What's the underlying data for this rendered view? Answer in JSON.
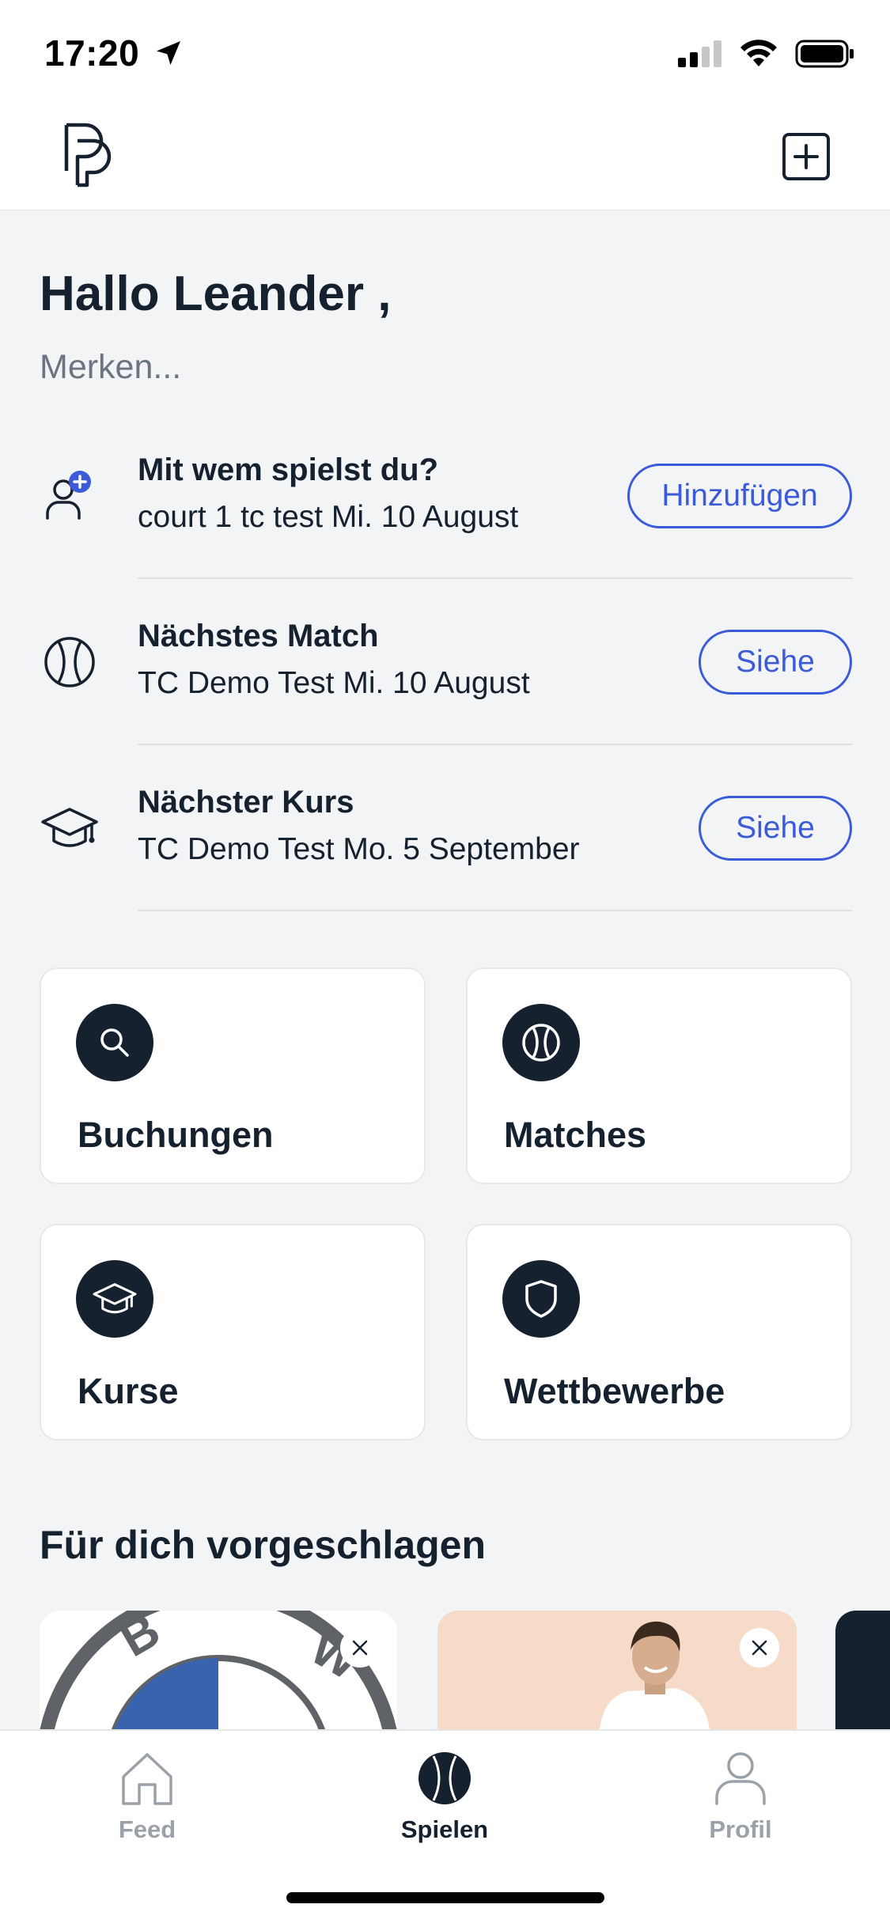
{
  "status_bar": {
    "time": "17:20"
  },
  "greeting": {
    "title": "Hallo Leander ,",
    "subtitle": "Merken..."
  },
  "reminders": [
    {
      "title": "Mit wem spielst du?",
      "subtitle": "court 1 tc test Mi. 10 August",
      "button": "Hinzufügen"
    },
    {
      "title": "Nächstes Match",
      "subtitle": "TC Demo Test Mi. 10 August",
      "button": "Siehe"
    },
    {
      "title": "Nächster Kurs",
      "subtitle": "TC Demo Test Mo. 5 September",
      "button": "Siehe"
    }
  ],
  "tiles": [
    {
      "label": "Buchungen",
      "icon": "search-icon"
    },
    {
      "label": "Matches",
      "icon": "tennis-ball-icon"
    },
    {
      "label": "Kurse",
      "icon": "graduation-cap-icon"
    },
    {
      "label": "Wettbewerbe",
      "icon": "shield-icon"
    }
  ],
  "suggestions": {
    "title": "Für dich vorgeschlagen"
  },
  "tab_bar": {
    "items": [
      {
        "label": "Feed",
        "icon": "home-icon",
        "active": false
      },
      {
        "label": "Spielen",
        "icon": "tennis-ball-icon",
        "active": true
      },
      {
        "label": "Profil",
        "icon": "user-icon",
        "active": false
      }
    ]
  },
  "colors": {
    "primary": "#15212f",
    "accent": "#3b5bd8",
    "background": "#f3f4f5",
    "muted": "#9aa1a9"
  }
}
